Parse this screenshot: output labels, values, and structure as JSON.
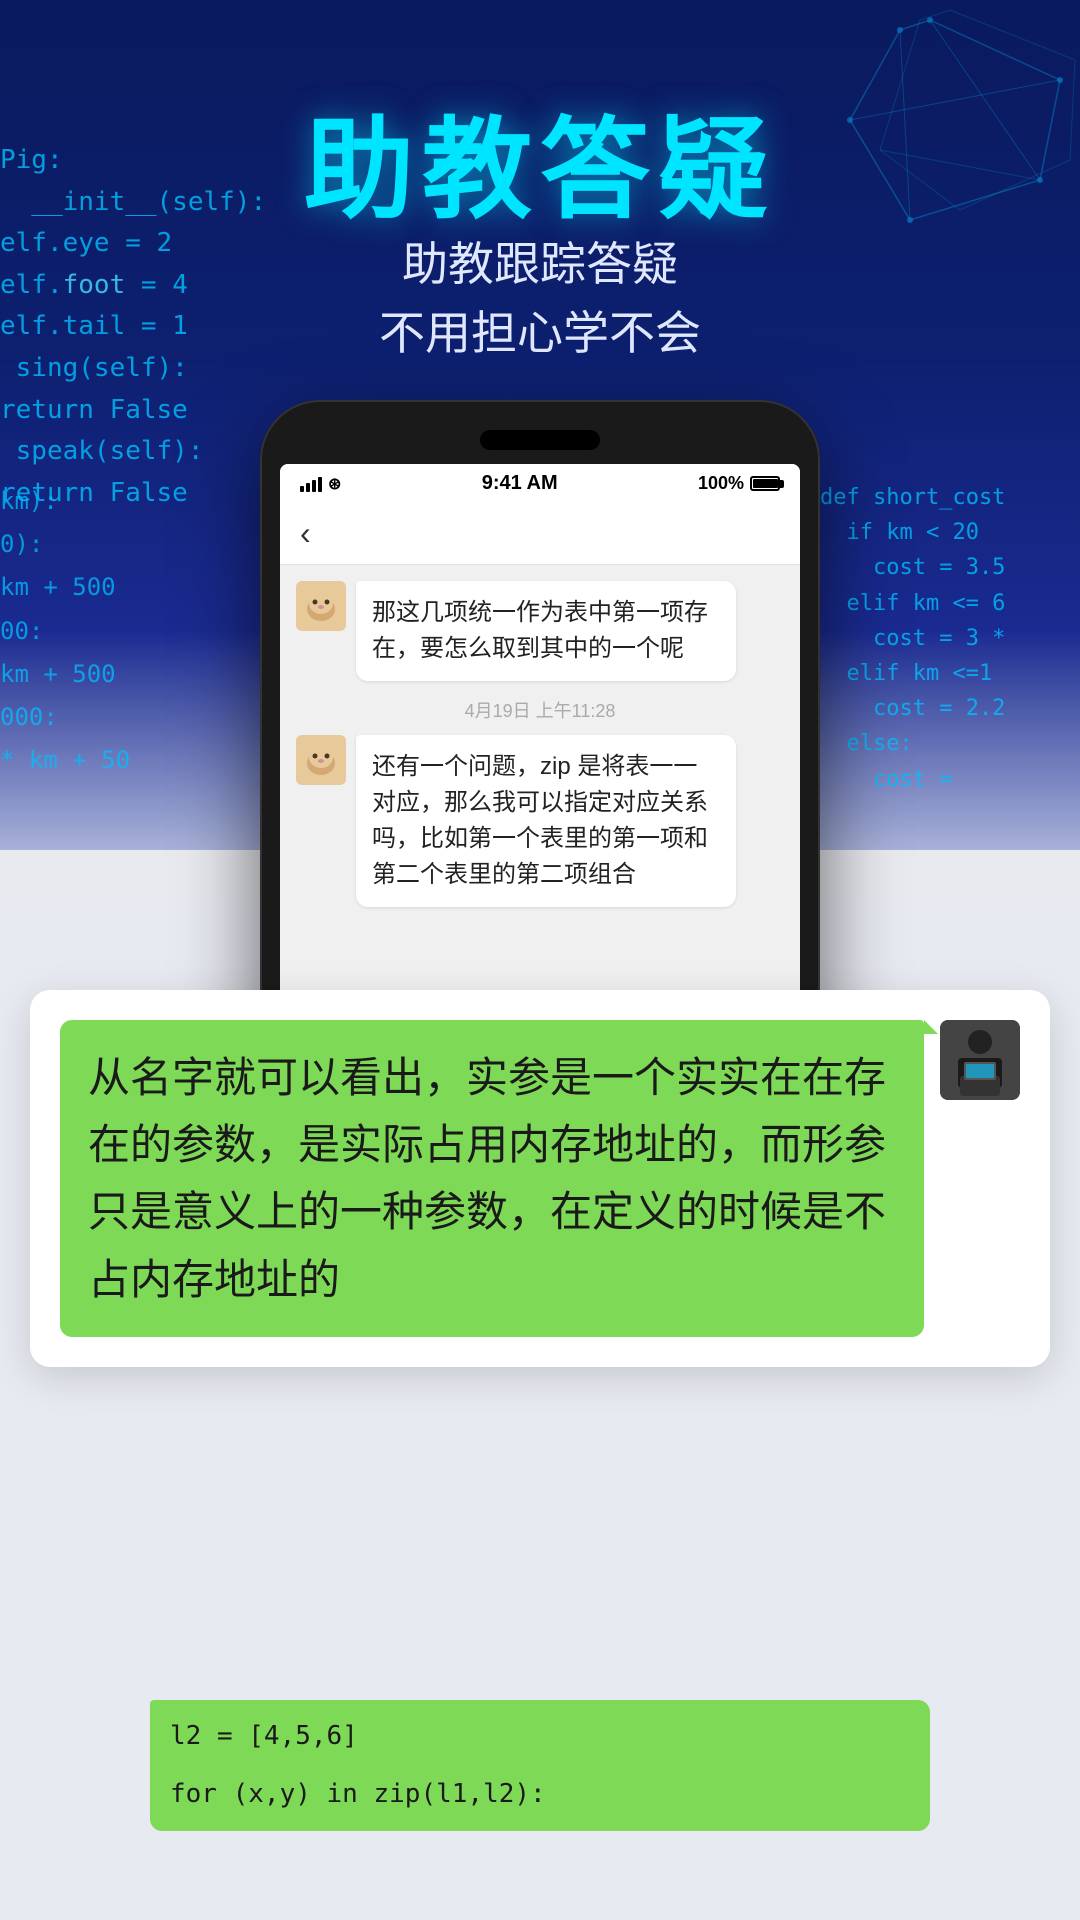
{
  "page": {
    "title": "助教答疑",
    "subtitle_line1": "助教跟踪答疑",
    "subtitle_line2": "不用担心学不会"
  },
  "status_bar": {
    "time": "9:41 AM",
    "battery": "100%"
  },
  "code_bg_left": {
    "lines": [
      "Pig:",
      "  __init__(self):",
      "elf.eye = 2",
      "elf.foot = 4",
      "elf.tail = 1",
      " sing(self):",
      "return False",
      " speak(self):",
      "return False"
    ]
  },
  "code_bg_right": {
    "lines": [
      "def short_cost",
      "  if km < 20",
      "    cost = 3.5",
      "  elif km <= 6",
      "    cost = 3 *",
      "  elif km <=1",
      "    cost = 2.2",
      "  else:",
      "    cost ="
    ]
  },
  "code_bg_left2": {
    "lines": [
      "km):",
      "0):",
      "km + 500",
      "00:",
      "km + 500",
      "000:",
      "* km + 50"
    ]
  },
  "chat": {
    "back_label": "‹",
    "message1": {
      "avatar_emoji": "🐱",
      "text": "那这几项统一作为表中第一项存在，要怎么取到其中的一个呢"
    },
    "timestamp": "4月19日 上午11:28",
    "message2": {
      "avatar_emoji": "🐱",
      "text": "还有一个问题，zip 是将表一一对应，那么我可以指定对应关系吗，比如第一个表里的第一项和第二个表里的第二项组合"
    }
  },
  "teacher_reply": {
    "text": "从名字就可以看出，实参是一个实实在在存在的参数，是实际占用内存地址的，而形参只是意义上的一种参数，在定义的时候是不占内存地址的",
    "avatar_emoji": "👨‍💻"
  },
  "bottom_code": {
    "line1": "l2 = [4,5,6]",
    "line2": "",
    "line3": "for (x,y) in zip(l1,l2):"
  },
  "colors": {
    "cyan_accent": "#00e5ff",
    "bg_dark": "#0a1a5e",
    "green_bubble": "#7ed957",
    "white": "#ffffff"
  }
}
